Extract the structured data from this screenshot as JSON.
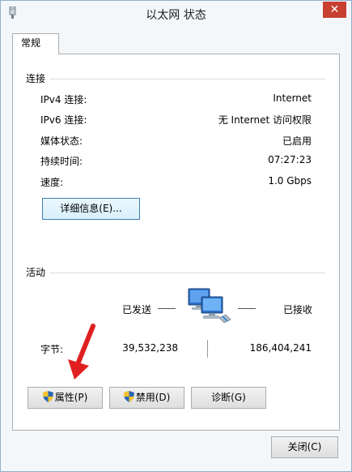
{
  "window": {
    "title": "以太网 状态",
    "close_glyph": "✕"
  },
  "tabs": [
    {
      "label": "常规"
    }
  ],
  "connection": {
    "heading": "连接",
    "rows": [
      {
        "label": "IPv4 连接:",
        "value": "Internet"
      },
      {
        "label": "IPv6 连接:",
        "value": "无 Internet 访问权限"
      },
      {
        "label": "媒体状态:",
        "value": "已启用"
      },
      {
        "label": "持续时间:",
        "value": "07:27:23"
      },
      {
        "label": "速度:",
        "value": "1.0 Gbps"
      }
    ],
    "details_button": "详细信息(E)..."
  },
  "activity": {
    "heading": "活动",
    "sent_label": "已发送",
    "received_label": "已接收",
    "bytes_label": "字节:",
    "bytes_sent": "39,532,238",
    "bytes_received": "186,404,241"
  },
  "buttons": {
    "properties": "属性(P)",
    "disable": "禁用(D)",
    "diagnose": "诊断(G)",
    "close": "关闭(C)"
  },
  "colors": {
    "accent": "#3c7fb1",
    "close_red": "#c84031",
    "arrow_red": "#e02020"
  },
  "icons": [
    "app-icon",
    "network-computers-icon",
    "shield-icon",
    "close-icon"
  ]
}
